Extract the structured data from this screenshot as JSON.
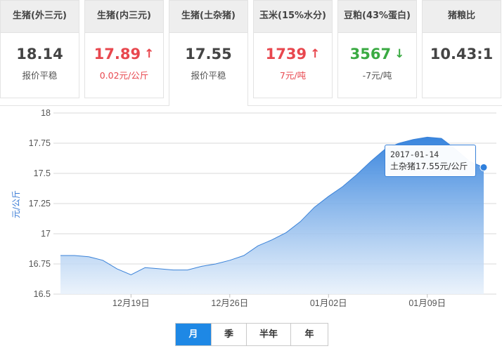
{
  "cards": [
    {
      "title": "生猪(外三元)",
      "value": "18.14",
      "trend": "flat",
      "sub": "报价平稳"
    },
    {
      "title": "生猪(内三元)",
      "value": "17.89",
      "trend": "up",
      "sub": "0.02元/公斤"
    },
    {
      "title": "生猪(土杂猪)",
      "value": "17.55",
      "trend": "flat",
      "sub": "报价平稳"
    },
    {
      "title": "玉米(15%水分)",
      "value": "1739",
      "trend": "up",
      "sub": "7元/吨"
    },
    {
      "title": "豆粕(43%蛋白)",
      "value": "3567",
      "trend": "down",
      "sub": "-7元/吨"
    },
    {
      "title": "猪粮比",
      "value": "10.43:1",
      "trend": "flat",
      "sub": ""
    }
  ],
  "icons": {
    "up": "↑",
    "down": "↓"
  },
  "tooltip": {
    "date": "2017-01-14",
    "text": "土杂猪17.55元/公斤"
  },
  "range_buttons": [
    "月",
    "季",
    "半年",
    "年"
  ],
  "range_active": "月",
  "colors": {
    "up": "#e8474e",
    "down": "#3aaa42",
    "accent": "#1e88e5",
    "area_top": "#2f7fdc",
    "area_bottom": "#e8f1fb"
  },
  "chart_data": {
    "type": "area",
    "ylabel": "元/公斤",
    "xlabel": "",
    "ylim": [
      16.5,
      18
    ],
    "yticks": [
      "16.5",
      "16.75",
      "17",
      "17.25",
      "17.5",
      "17.75",
      "18"
    ],
    "xticks": [
      "12月19日",
      "12月26日",
      "01月02日",
      "01月09日"
    ],
    "x_index_of_ticks": [
      5,
      12,
      19,
      26
    ],
    "grid": true,
    "series": [
      {
        "values": [
          16.82,
          16.82,
          16.81,
          16.78,
          16.71,
          16.66,
          16.72,
          16.71,
          16.7,
          16.7,
          16.73,
          16.75,
          16.78,
          16.82,
          16.9,
          16.95,
          17.01,
          17.1,
          17.22,
          17.31,
          17.39,
          17.49,
          17.6,
          17.7,
          17.75,
          17.78,
          17.8,
          17.79,
          17.7,
          17.6,
          17.55
        ]
      }
    ]
  }
}
